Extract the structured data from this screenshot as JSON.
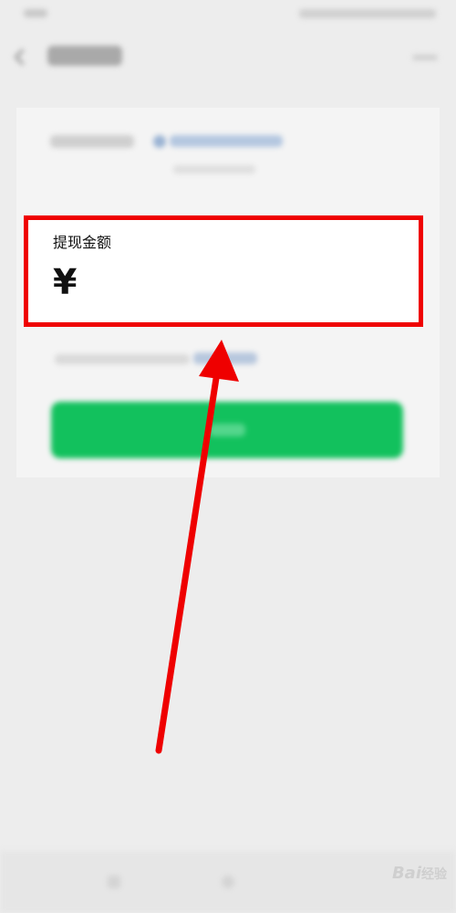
{
  "amount_card": {
    "title": "提现金额",
    "currency_symbol": "¥"
  },
  "watermark": {
    "brand": "Bai",
    "suffix": "经验"
  },
  "colors": {
    "background": "#ededed",
    "highlight_border": "#ef0000",
    "arrow": "#ef0000",
    "primary_button": "#12c15d",
    "link": "#576b95"
  },
  "icons": [
    "back-icon",
    "more-icon",
    "bank-icon",
    "annotation-arrow-icon"
  ]
}
